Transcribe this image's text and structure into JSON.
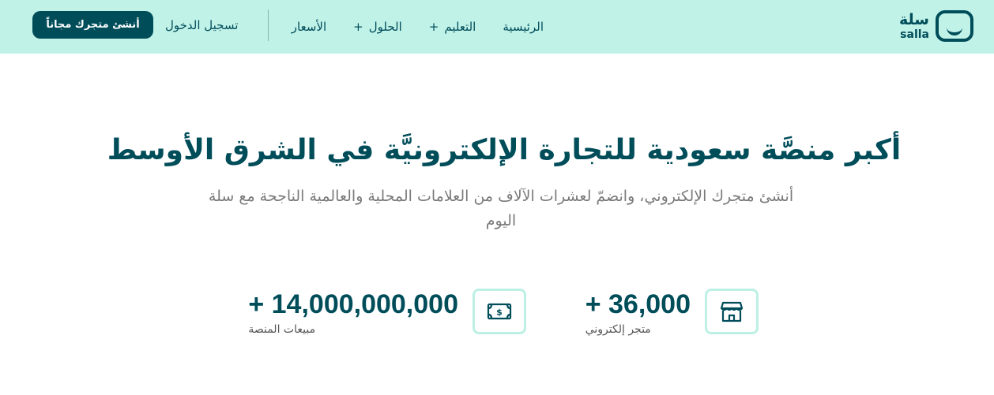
{
  "logo": {
    "arabic": "سلة",
    "latin": "salla"
  },
  "nav": {
    "links": [
      {
        "label": "الرئيسية",
        "has_plus": false
      },
      {
        "label": "التعليم",
        "has_plus": true
      },
      {
        "label": "الحلول",
        "has_plus": true
      },
      {
        "label": "الأسعار",
        "has_plus": false
      }
    ],
    "login_label": "تسجيل الدخول",
    "cta_label": "أنشئ متجرك مجاناً"
  },
  "hero": {
    "title": "أكبر منصَّة سعودية للتجارة الإلكترونيَّة في الشرق الأوسط",
    "subtitle": "أنشئ متجرك الإلكتروني، وانضمّ لعشرات الآلاف من العلامات المحلية والعالمية الناجحة مع سلة اليوم"
  },
  "stats": [
    {
      "value": "+ 36,000",
      "label": "متجر إلكتروني",
      "icon": "store-icon"
    },
    {
      "value": "+ 14,000,000,000",
      "label": "مبيعات المنصة",
      "icon": "money-icon"
    }
  ],
  "colors": {
    "brand": "#004d5a",
    "nav_bg": "#c1f2e8",
    "icon_border": "#bdf0e5"
  }
}
